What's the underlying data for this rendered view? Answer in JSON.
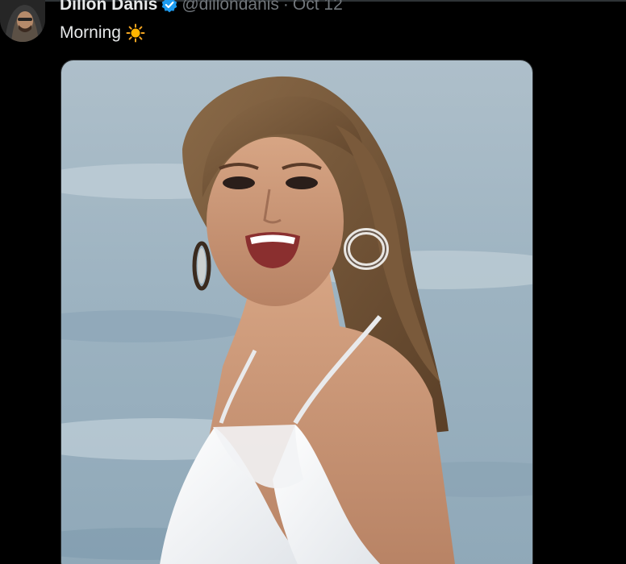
{
  "tweet": {
    "author": {
      "display_name": "Dillon Danis",
      "handle": "@dillondanis",
      "verified": true,
      "avatar_icon": "avatar-photo"
    },
    "separator": "·",
    "date": "Oct 12",
    "text": "Morning",
    "emoji": "sun-emoji",
    "media": {
      "type": "photo",
      "icon": "photo-image"
    }
  },
  "colors": {
    "background": "#000000",
    "primary_text": "#e7e9ea",
    "secondary_text": "#71767b",
    "verified_blue": "#1d9bf0",
    "border": "#2f3336"
  }
}
